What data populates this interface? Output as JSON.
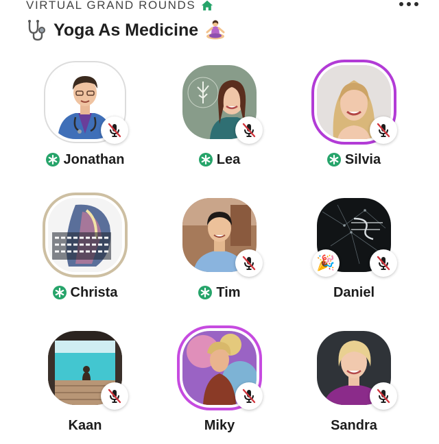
{
  "header": {
    "club_name": "VIRTUAL GRAND ROUNDS",
    "club_icon": "house-icon",
    "menu_icon": "more-icon"
  },
  "room": {
    "title": "Yoga As Medicine",
    "leading_icon": "stethoscope-icon",
    "trailing_icon": "yoga-icon"
  },
  "colors": {
    "moderator_green": "#26a46a",
    "mute_red": "#d0333b",
    "ring_purple": "#b23bd6"
  },
  "speakers": [
    {
      "name": "Jonathan",
      "moderator": true,
      "muted": true
    },
    {
      "name": "Lea",
      "moderator": true,
      "muted": true
    },
    {
      "name": "Silvia",
      "moderator": true,
      "muted": true
    },
    {
      "name": "Christa",
      "moderator": true,
      "muted": false
    },
    {
      "name": "Tim",
      "moderator": true,
      "muted": true
    },
    {
      "name": "Daniel",
      "moderator": false,
      "muted": true,
      "badge": "party-popper-icon"
    },
    {
      "name": "Kaan",
      "moderator": false,
      "muted": true
    },
    {
      "name": "Miky",
      "moderator": false,
      "muted": true
    },
    {
      "name": "Sandra",
      "moderator": false,
      "muted": true
    }
  ]
}
